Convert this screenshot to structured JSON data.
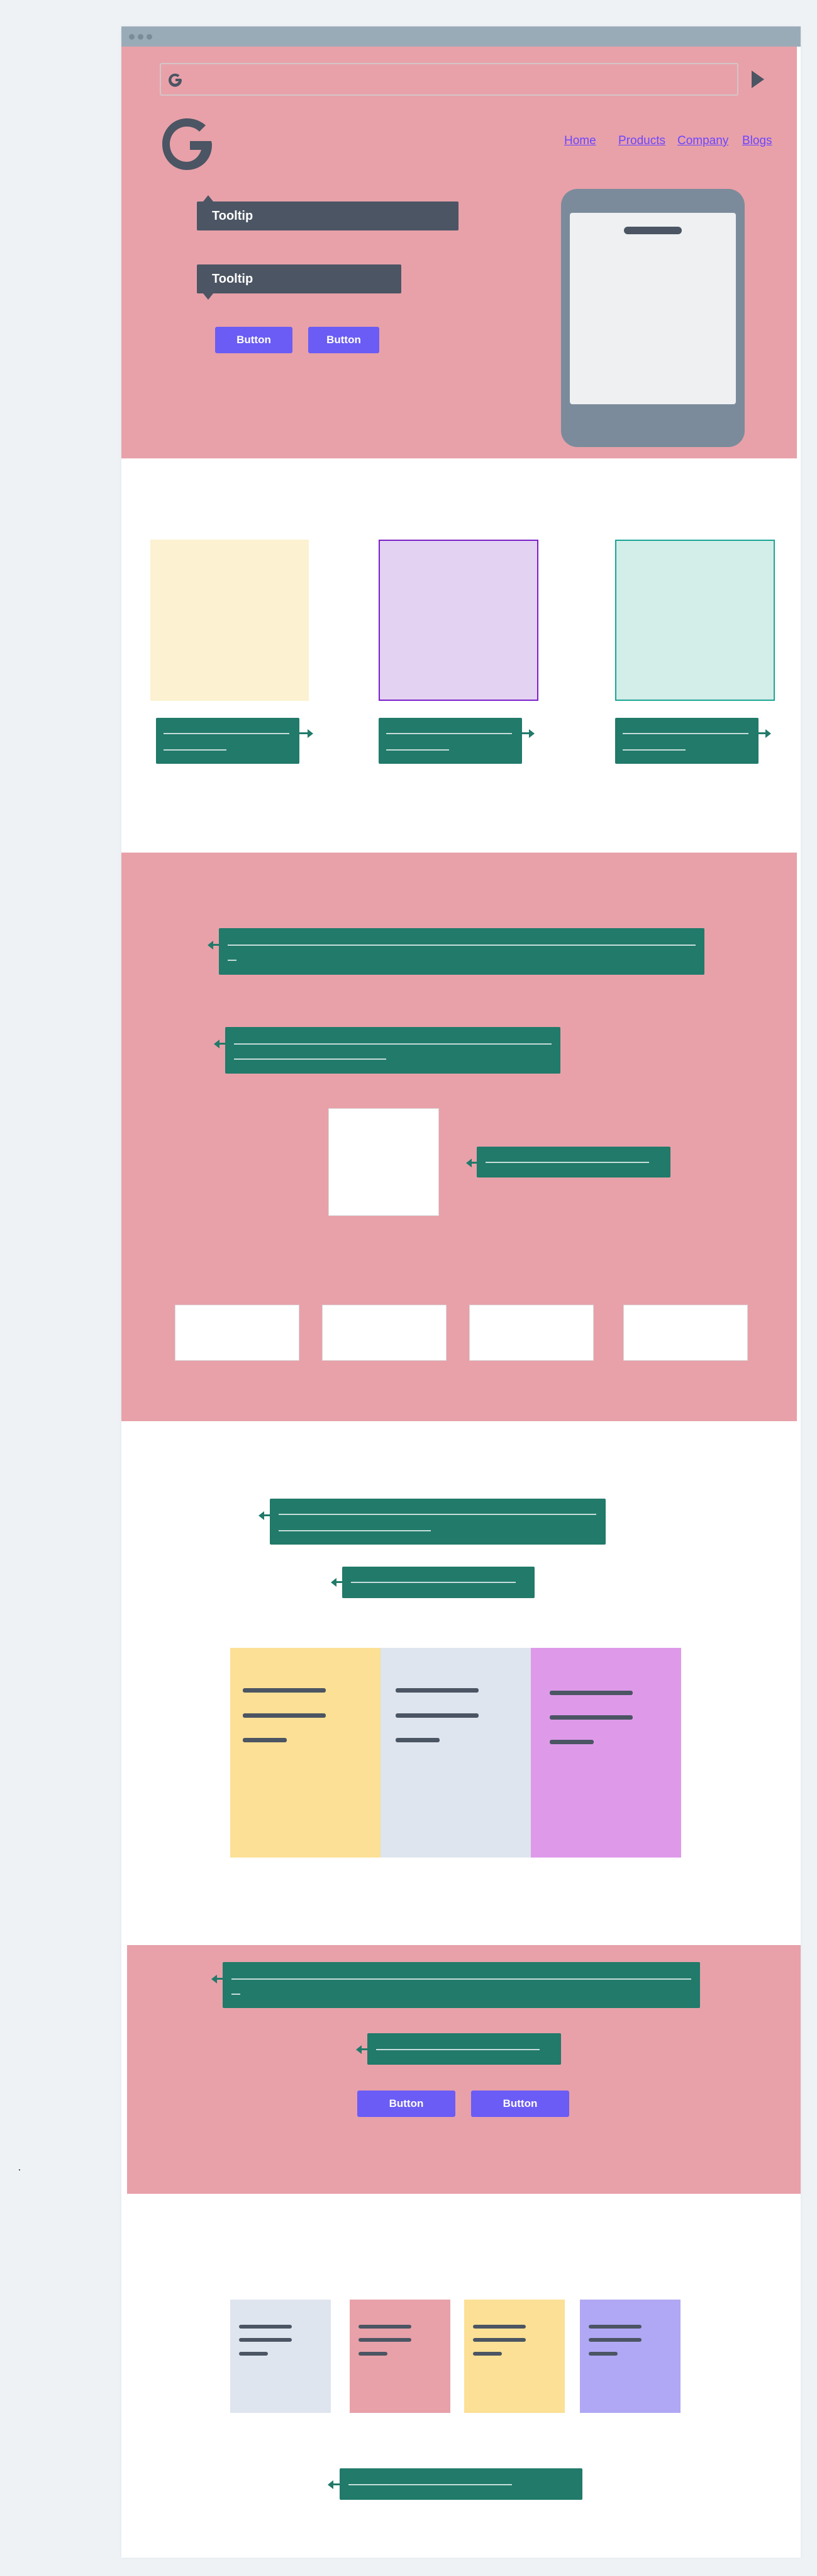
{
  "window": {
    "title": ""
  },
  "search": {
    "value": "",
    "placeholder": "",
    "logo_icon": "google-g-icon",
    "submit_icon": "play-icon"
  },
  "nav": {
    "items": [
      "Home",
      "Products",
      "Company",
      "Blogs"
    ]
  },
  "hero": {
    "logo_icon": "google-g-icon",
    "tooltip_1": "Tooltip",
    "tooltip_2": "Tooltip",
    "button_1": "Button",
    "button_2": "Button",
    "device_icon": "smartphone-icon"
  },
  "features": {
    "cards": [
      {
        "fill": "#fcf1d0",
        "border": "#fcf1d0"
      },
      {
        "fill": "#e4d2f3",
        "border": "#7b1fc9"
      },
      {
        "fill": "#d3ede9",
        "border": "#1aa594"
      }
    ]
  },
  "cta": {
    "button_1": "Button",
    "button_2": "Button"
  },
  "colors": {
    "section_pink": "#e8a1a9",
    "callout_green": "#217a6a",
    "tooltip_slate": "#4b5563",
    "button_purple": "#6b5cf5",
    "link_purple": "#6b46ff"
  },
  "pricing": {
    "columns": [
      {
        "fill": "#fbe095"
      },
      {
        "fill": "#dfe5ee"
      },
      {
        "fill": "#de9ae9"
      }
    ]
  },
  "tiles": {
    "items": [
      {
        "fill": "#dfe5ee"
      },
      {
        "fill": "#e8a1a9"
      },
      {
        "fill": "#fbe095"
      },
      {
        "fill": "#b0a8f4"
      }
    ]
  }
}
